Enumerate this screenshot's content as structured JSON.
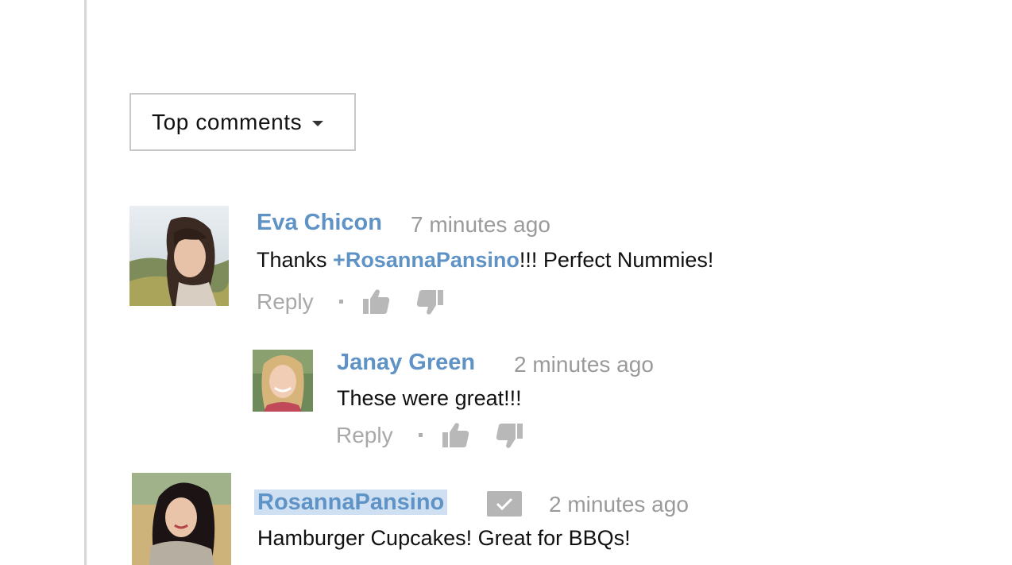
{
  "sort": {
    "label": "Top comments"
  },
  "comments": [
    {
      "author": "Eva Chicon",
      "time": "7 minutes ago",
      "text_prefix": "Thanks ",
      "mention": "+RosannaPansino",
      "text_suffix": "!!! Perfect Nummies!",
      "reply_label": "Reply"
    },
    {
      "author": "Janay Green",
      "time": "2 minutes ago",
      "text": "These were great!!!",
      "reply_label": "Reply"
    },
    {
      "author": "RosannaPansino",
      "time": "2 minutes ago",
      "text": "Hamburger Cupcakes! Great for BBQs!",
      "verified": true
    }
  ],
  "colors": {
    "link": "#5f93c6",
    "muted": "#9a9a9a",
    "highlight": "#cfe0f3"
  },
  "icons": [
    "caret-down-icon",
    "thumbs-up-icon",
    "thumbs-down-icon",
    "verified-check-icon"
  ]
}
